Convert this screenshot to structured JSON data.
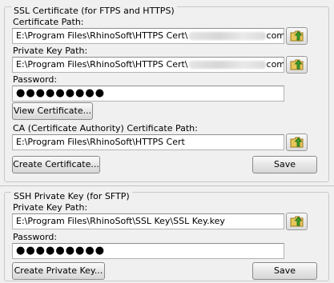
{
  "ssl": {
    "title": "SSL Certificate (for FTPS and HTTPS)",
    "cert_path_label": "Certificate Path:",
    "cert_path_value_start": "E:\\Program Files\\RhinoSoft\\HTTPS Cert\\",
    "cert_path_value_end": "com.crt",
    "key_path_label": "Private Key Path:",
    "key_path_value_start": "E:\\Program Files\\RhinoSoft\\HTTPS Cert\\",
    "key_path_value_end": "com.key",
    "password_label": "Password:",
    "password_value": "●●●●●●●●●",
    "view_certificate_label": "View Certificate...",
    "ca_path_label": "CA (Certificate Authority) Certificate Path:",
    "ca_path_value": "E:\\Program Files\\RhinoSoft\\HTTPS Cert",
    "create_certificate_label": "Create Certificate...",
    "save_label": "Save"
  },
  "ssh": {
    "title": "SSH Private Key (for SFTP)",
    "key_path_label": "Private Key Path:",
    "key_path_value": "E:\\Program Files\\RhinoSoft\\SSL Key\\SSL Key.key",
    "password_label": "Password:",
    "password_value": "●●●●●●●●●",
    "create_private_key_label": "Create Private Key...",
    "save_label": "Save"
  },
  "icons": {
    "browse": "folder-with-green-arrow-icon"
  }
}
